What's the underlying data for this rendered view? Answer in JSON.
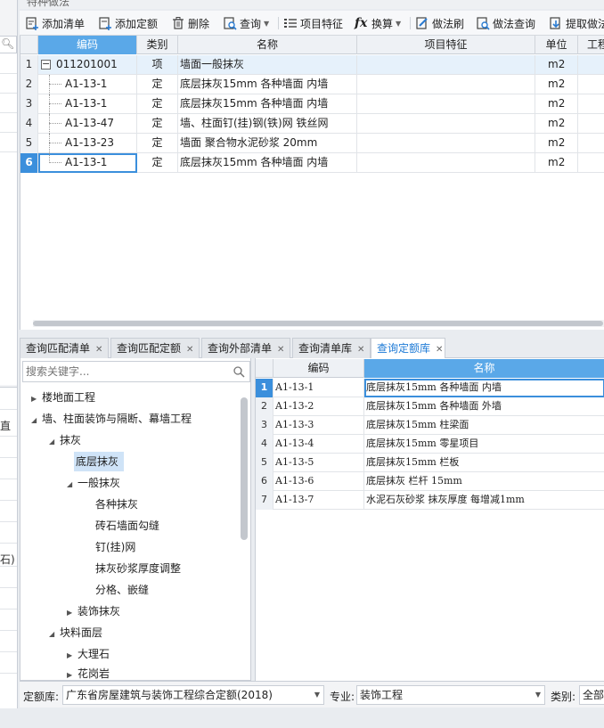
{
  "panel_title": "特种做法",
  "toolbar": {
    "add_list": "添加清单",
    "add_quota": "添加定额",
    "delete": "删除",
    "query": "查询",
    "item_feature": "项目特征",
    "convert": "换算",
    "method_brush": "做法刷",
    "method_query": "做法查询",
    "extract_method": "提取做法"
  },
  "upper_grid": {
    "columns": [
      "编码",
      "类别",
      "名称",
      "项目特征",
      "单位",
      "工程"
    ],
    "rows": [
      {
        "num": "1",
        "code": "011201001",
        "type": "项",
        "name": "墙面一般抹灰",
        "feature": "",
        "unit": "m2"
      },
      {
        "num": "2",
        "code": "A1-13-1",
        "type": "定",
        "name": "底层抹灰15mm 各种墙面 内墙",
        "feature": "",
        "unit": "m2"
      },
      {
        "num": "3",
        "code": "A1-13-1",
        "type": "定",
        "name": "底层抹灰15mm 各种墙面 内墙",
        "feature": "",
        "unit": "m2"
      },
      {
        "num": "4",
        "code": "A1-13-47",
        "type": "定",
        "name": "墙、柱面钉(挂)钢(铁)网 铁丝网",
        "feature": "",
        "unit": "m2"
      },
      {
        "num": "5",
        "code": "A1-13-23",
        "type": "定",
        "name": "墙面 聚合物水泥砂浆 20mm",
        "feature": "",
        "unit": "m2"
      },
      {
        "num": "6",
        "code": "A1-13-1",
        "type": "定",
        "name": "底层抹灰15mm 各种墙面 内墙",
        "feature": "",
        "unit": "m2"
      }
    ]
  },
  "tabs": [
    {
      "label": "查询匹配清单"
    },
    {
      "label": "查询匹配定额"
    },
    {
      "label": "查询外部清单"
    },
    {
      "label": "查询清单库"
    },
    {
      "label": "查询定额库"
    }
  ],
  "search": {
    "placeholder": "搜索关键字..."
  },
  "tree": [
    {
      "label": "楼地面工程",
      "arrow": "▶"
    },
    {
      "label": "墙、柱面装饰与隔断、幕墙工程",
      "arrow": "◢"
    },
    {
      "label": "抹灰",
      "arrow": "◢"
    },
    {
      "label": "底层抹灰",
      "arrow": ""
    },
    {
      "label": "一般抹灰",
      "arrow": "◢"
    },
    {
      "label": "各种抹灰",
      "arrow": ""
    },
    {
      "label": "砖石墙面勾缝",
      "arrow": ""
    },
    {
      "label": "钉(挂)网",
      "arrow": ""
    },
    {
      "label": "抹灰砂浆厚度调整",
      "arrow": ""
    },
    {
      "label": "分格、嵌缝",
      "arrow": ""
    },
    {
      "label": "装饰抹灰",
      "arrow": "▶"
    },
    {
      "label": "块料面层",
      "arrow": "◢"
    },
    {
      "label": "大理石",
      "arrow": "▶"
    },
    {
      "label": "花岗岩",
      "arrow": "▶"
    }
  ],
  "lower_grid": {
    "columns": [
      "编码",
      "名称"
    ],
    "rows": [
      {
        "num": "1",
        "code": "A1-13-1",
        "name": "底层抹灰15mm 各种墙面 内墙"
      },
      {
        "num": "2",
        "code": "A1-13-2",
        "name": "底层抹灰15mm 各种墙面 外墙"
      },
      {
        "num": "3",
        "code": "A1-13-3",
        "name": "底层抹灰15mm 柱梁面"
      },
      {
        "num": "4",
        "code": "A1-13-4",
        "name": "底层抹灰15mm 零星项目"
      },
      {
        "num": "5",
        "code": "A1-13-5",
        "name": "底层抹灰15mm 栏板"
      },
      {
        "num": "6",
        "code": "A1-13-6",
        "name": "底层抹灰 栏杆 15mm"
      },
      {
        "num": "7",
        "code": "A1-13-7",
        "name": "水泥石灰砂浆 抹灰厚度 每增减1mm"
      }
    ]
  },
  "bottom": {
    "quota_label": "定额库:",
    "quota_value": "广东省房屋建筑与装饰工程综合定额(2018)",
    "major_label": "专业:",
    "major_value": "装饰工程",
    "category_label": "类别:",
    "category_value": "全部"
  },
  "left_strip": {
    "snippets": [
      "直",
      "石)"
    ]
  },
  "colors": {
    "accent": "#3b8fdc",
    "header_selected": "#5aa8e8",
    "selected_bg": "#cfe3f7"
  }
}
